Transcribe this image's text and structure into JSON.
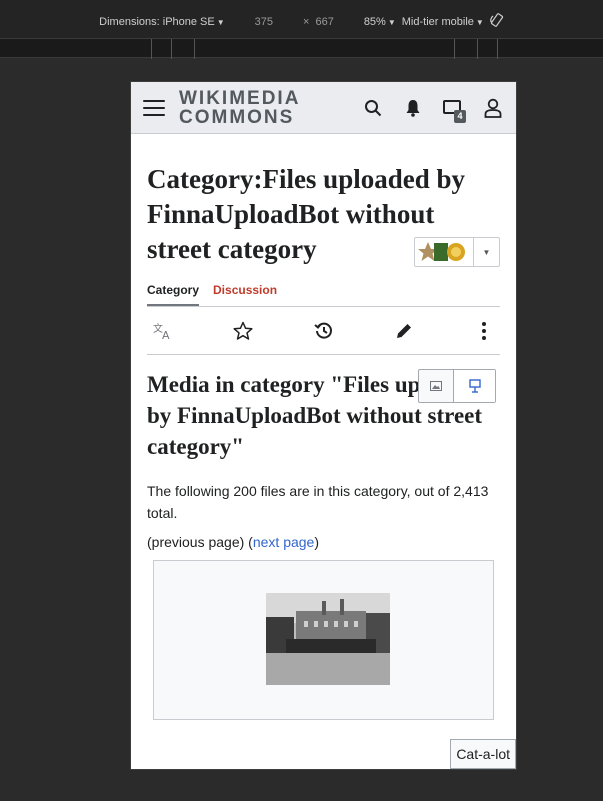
{
  "devtools": {
    "dimensions_label": "Dimensions: iPhone SE",
    "width": "375",
    "times": "×",
    "height": "667",
    "zoom": "85%",
    "throttle": "Mid-tier mobile"
  },
  "header": {
    "logo_line1": "WIKIMEDIA",
    "logo_line2": "COMMONS",
    "notice_count": "4"
  },
  "page": {
    "title": "Category:Files uploaded by FinnaUploadBot without street category"
  },
  "tabs": [
    {
      "label": "Category"
    },
    {
      "label": "Discussion"
    }
  ],
  "section": {
    "title": "Media in category \"Files uploaded by FinnaUploadBot without street category\"",
    "description": "The following 200 files are in this category, out of 2,413 total.",
    "prev": "(previous page)",
    "open_paren": "(",
    "next": "next page",
    "close_paren": ")"
  },
  "gadget": {
    "catalot": "Cat-a-lot"
  },
  "colors": {
    "header_bg": "#eaecf0",
    "link": "#3366cc",
    "discussion_red": "#bf3c2c"
  }
}
